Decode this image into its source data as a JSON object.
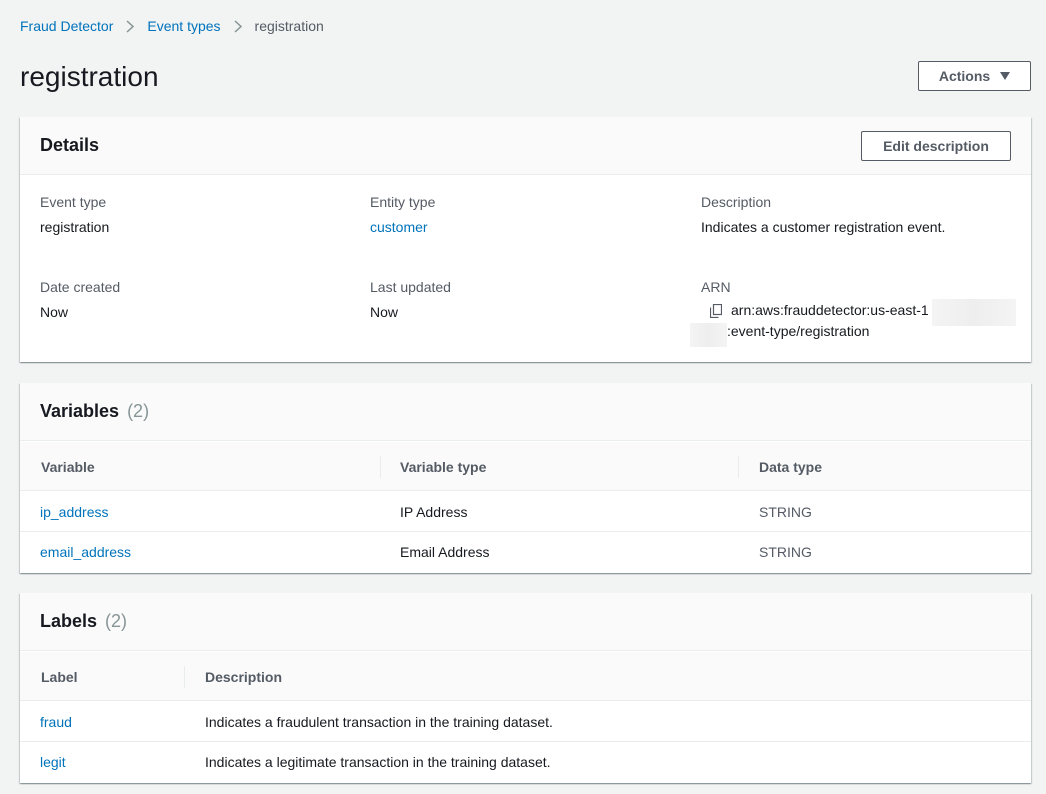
{
  "breadcrumb": {
    "items": [
      "Fraud Detector",
      "Event types"
    ],
    "current": "registration"
  },
  "page": {
    "title": "registration",
    "actions_label": "Actions"
  },
  "details": {
    "title": "Details",
    "edit_label": "Edit description",
    "event_type_label": "Event type",
    "event_type_value": "registration",
    "entity_type_label": "Entity type",
    "entity_type_value": "customer",
    "description_label": "Description",
    "description_value": "Indicates a customer registration event.",
    "date_created_label": "Date created",
    "date_created_value": "Now",
    "last_updated_label": "Last updated",
    "last_updated_value": "Now",
    "arn_label": "ARN",
    "arn_part1": "arn:aws:frauddetector:us-east-1",
    "arn_part2": ":event-type/registration"
  },
  "variables": {
    "title": "Variables",
    "count": "(2)",
    "columns": [
      "Variable",
      "Variable type",
      "Data type"
    ],
    "rows": [
      {
        "name": "ip_address",
        "type": "IP Address",
        "data_type": "STRING"
      },
      {
        "name": "email_address",
        "type": "Email Address",
        "data_type": "STRING"
      }
    ]
  },
  "labels": {
    "title": "Labels",
    "count": "(2)",
    "columns": [
      "Label",
      "Description"
    ],
    "rows": [
      {
        "name": "fraud",
        "description": "Indicates a fraudulent transaction in the training dataset."
      },
      {
        "name": "legit",
        "description": "Indicates a legitimate transaction in the training dataset."
      }
    ]
  },
  "colors": {
    "link": "#0073bb",
    "text": "#16191f",
    "muted": "#545b64",
    "background": "#f2f3f3"
  }
}
